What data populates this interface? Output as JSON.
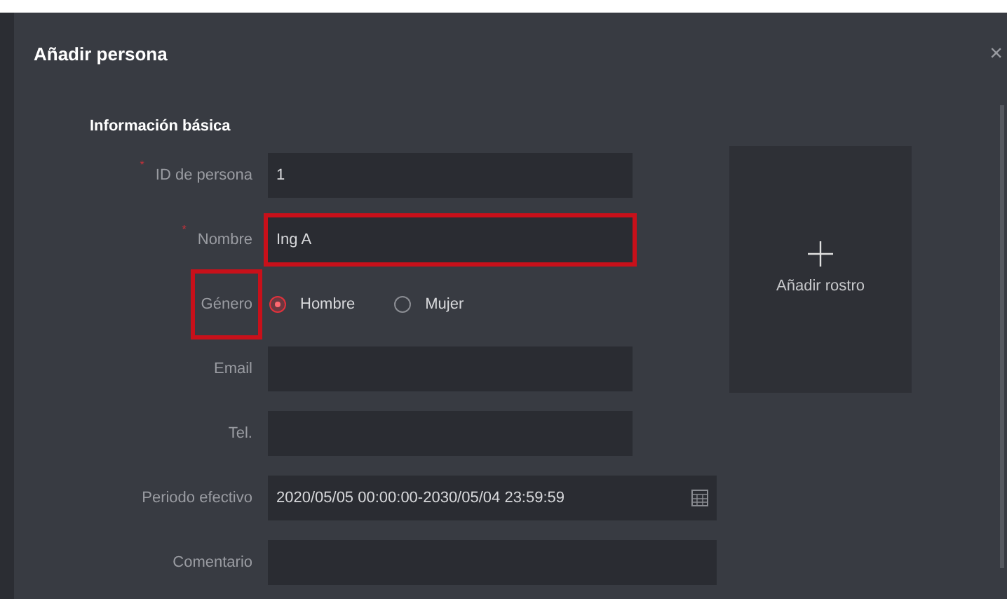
{
  "dialog": {
    "title": "Añadir persona",
    "close": "×"
  },
  "section": {
    "title": "Información básica"
  },
  "rows": [
    {
      "kind": "text",
      "label": "ID de persona",
      "required_mark": "*",
      "value": "1",
      "wide": false,
      "label_highlighted": false,
      "field_highlighted": false
    },
    {
      "kind": "text",
      "label": "Nombre",
      "required_mark": "*",
      "value": "Ing A",
      "wide": false,
      "label_highlighted": false,
      "field_highlighted": true
    },
    {
      "kind": "radio",
      "label": "Género",
      "label_highlighted": true,
      "options": [
        {
          "label": "Hombre",
          "selected": true
        },
        {
          "label": "Mujer",
          "selected": false
        }
      ]
    },
    {
      "kind": "text",
      "label": "Email",
      "value": "",
      "wide": false,
      "label_highlighted": false,
      "field_highlighted": false
    },
    {
      "kind": "text",
      "label": "Tel.",
      "value": "",
      "wide": false,
      "label_highlighted": false,
      "field_highlighted": false
    },
    {
      "kind": "date",
      "label": "Periodo efectivo",
      "value": "2020/05/05 00:00:00-2030/05/04 23:59:59",
      "wide": true,
      "label_highlighted": false,
      "field_highlighted": false
    },
    {
      "kind": "text",
      "label": "Comentario",
      "value": "",
      "wide": true,
      "label_highlighted": false,
      "field_highlighted": false
    }
  ],
  "face": {
    "label": "Añadir rostro"
  }
}
